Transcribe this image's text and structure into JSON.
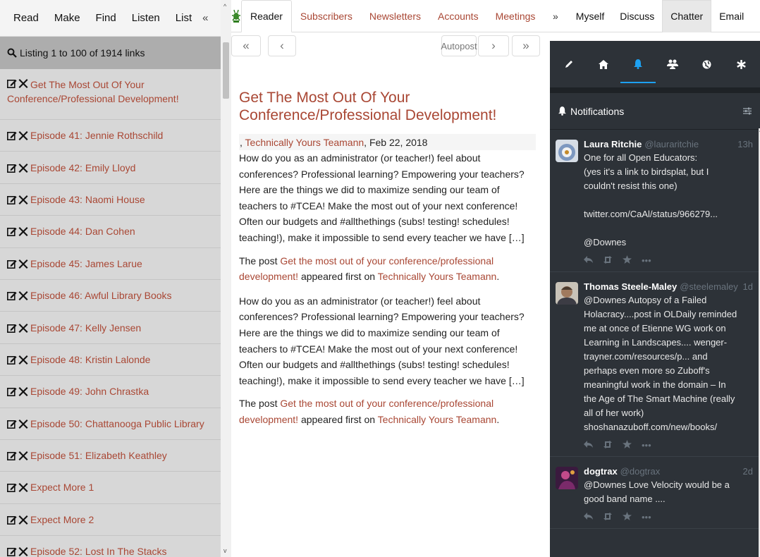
{
  "left": {
    "tabs": [
      "Read",
      "Make",
      "Find",
      "Listen",
      "List"
    ],
    "collapse": "«",
    "listing": "Listing 1 to 100 of 1914 links",
    "links": [
      "Get The Most Out Of Your Conference/Professional Development!",
      "Episode 41: Jennie Rothschild",
      "Episode 42: Emily Lloyd",
      "Episode 43: Naomi House",
      "Episode 44: Dan Cohen",
      "Episode 45: James Larue",
      "Episode 46: Awful Library Books",
      "Episode 47: Kelly Jensen",
      "Episode 48: Kristin Lalonde",
      "Episode 49: John Chrastka",
      "Episode 50: Chattanooga Public Library",
      "Episode 51: Elizabeth Keathley",
      "Expect More 1",
      "Expect More 2",
      "Episode 52: Lost In The Stacks"
    ]
  },
  "mid": {
    "tabs": [
      "Reader",
      "Subscribers",
      "Newsletters",
      "Accounts",
      "Meetings"
    ],
    "nav": {
      "first": "«",
      "prev": "‹",
      "autopost": "Autopost",
      "next": "›",
      "last": "»"
    },
    "title": "Get The Most Out Of Your Conference/Professional Development!",
    "byline_prefix": ", ",
    "byline_author": "Technically Yours Teamann",
    "byline_date": ", Feb 22, 2018",
    "para1": "How do you as an administrator (or teacher!) feel about conferences? Professional learning? Empowering your teachers?Here are the things we did to maximize sending our team of teachers to #TCEA! Make the most out of your next conference! Often our budgets and #allthethings (subs! testing! schedules! teaching!), make it impossible to send every teacher we have […]",
    "post_prefix": "The post ",
    "post_link": "Get the most out of your conference/professional development!",
    "post_mid": " appeared first on ",
    "post_site": "Technically Yours Teamann",
    "post_suffix": ".",
    "para2": "How do you as an administrator (or teacher!) feel about conferences? Professional learning? Empowering your teachers?Here are the things we did to maximize sending our team of teachers to #TCEA! Make the most out of your next conference! Often our budgets and #allthethings (subs! testing! schedules! teaching!), make it impossible to send every teacher we have […]"
  },
  "right": {
    "expand": "»",
    "tabs": [
      "Myself",
      "Discuss",
      "Chatter",
      "Email"
    ],
    "notifications_title": "Notifications",
    "tweets": [
      {
        "name": "Laura Ritchie",
        "handle": "@lauraritchie",
        "time": "13h",
        "text": "One for all Open Educators:\n(yes it's a link to birdsplat, but I couldn't resist this one)\n\ntwitter.com/CaAl/status/966279...\n\n@Downes"
      },
      {
        "name": "Thomas Steele-Maley",
        "handle": "@steelemaley",
        "time": "1d",
        "text": "@Downes Autopsy of a Failed Holacracy....post in OLDaily reminded me at once of Etienne WG work on Learning in Landscapes.... wenger-trayner.com/resources/p... and perhaps even more so  Zuboff's meaningful work in the domain – In the Age of The Smart Machine (really all of her work)\nshoshanazuboff.com/new/books/"
      },
      {
        "name": "dogtrax",
        "handle": "@dogtrax",
        "time": "2d",
        "text": "@Downes Love Velocity would be a good band name ...."
      }
    ]
  }
}
